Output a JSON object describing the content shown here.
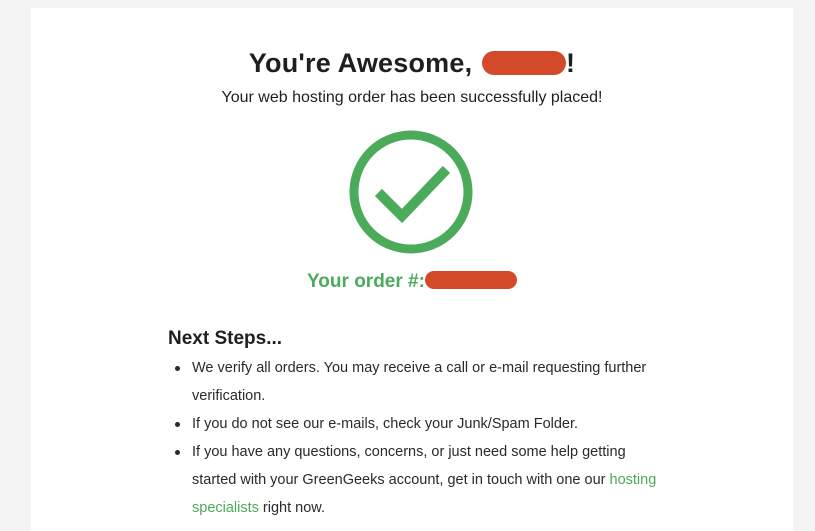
{
  "header": {
    "title": "You're Awesome,",
    "title_end": "!",
    "subtitle": "Your web hosting order has been successfully placed!"
  },
  "order": {
    "label": "Your order #:"
  },
  "colors": {
    "accent": "#4caa5b",
    "redaction": "#d34a2a"
  },
  "icons": {
    "success": "check-circle-icon"
  },
  "next_steps": {
    "title": "Next Steps...",
    "items": [
      "We verify all orders. You may receive a call or e-mail requesting further verification.",
      "If you do not see our e-mails, check your Junk/Spam Folder."
    ],
    "item3_before": "If you have any questions, concerns, or just need some help getting started with your GreenGeeks account, get in touch with one our",
    "item3_link": "hosting specialists",
    "item3_after": "right now."
  }
}
